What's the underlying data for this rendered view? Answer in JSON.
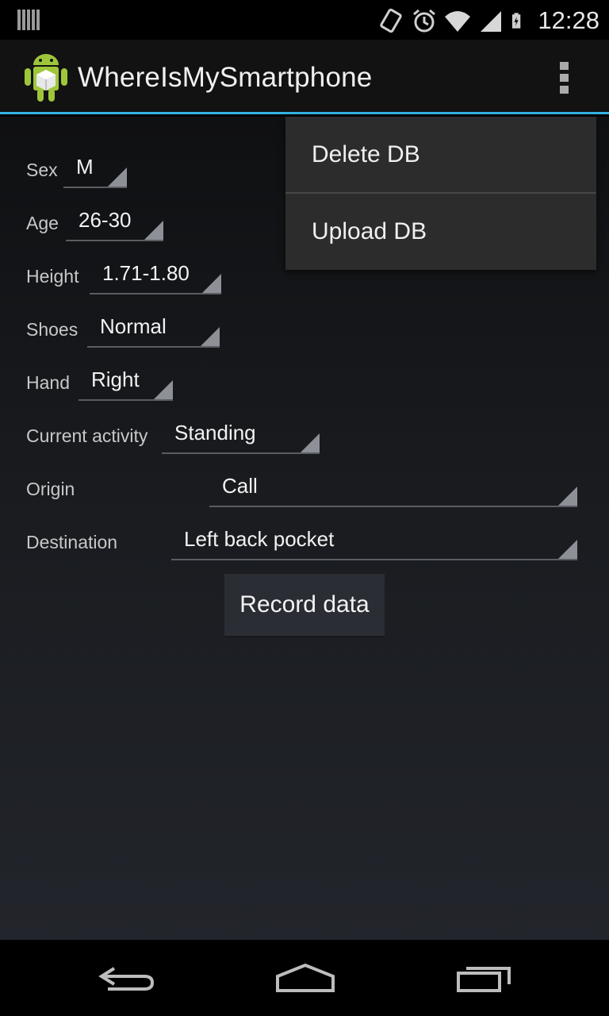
{
  "status_bar": {
    "time": "12:28",
    "icons": [
      "sim-icon",
      "vibrate-icon",
      "alarm-icon",
      "wifi-icon",
      "signal-icon",
      "battery-icon"
    ]
  },
  "action_bar": {
    "title": "WhereIsMySmartphone",
    "app_icon": "android-icon",
    "overflow_icon": "overflow-menu-icon",
    "accent_color": "#33b5e5"
  },
  "form": {
    "fields": [
      {
        "label": "Sex",
        "value": "M"
      },
      {
        "label": "Age",
        "value": "26-30"
      },
      {
        "label": "Height",
        "value": "1.71-1.80"
      },
      {
        "label": "Shoes",
        "value": "Normal"
      },
      {
        "label": "Hand",
        "value": "Right"
      },
      {
        "label": "Current activity",
        "value": "Standing"
      },
      {
        "label": "Origin",
        "value": "Call"
      },
      {
        "label": "Destination",
        "value": "Left back pocket"
      }
    ],
    "record_button": "Record data"
  },
  "overflow_menu": {
    "items": [
      {
        "label": "Delete DB"
      },
      {
        "label": "Upload DB"
      }
    ]
  },
  "nav_bar": {
    "icons": [
      "back-icon",
      "home-icon",
      "recents-icon"
    ]
  }
}
